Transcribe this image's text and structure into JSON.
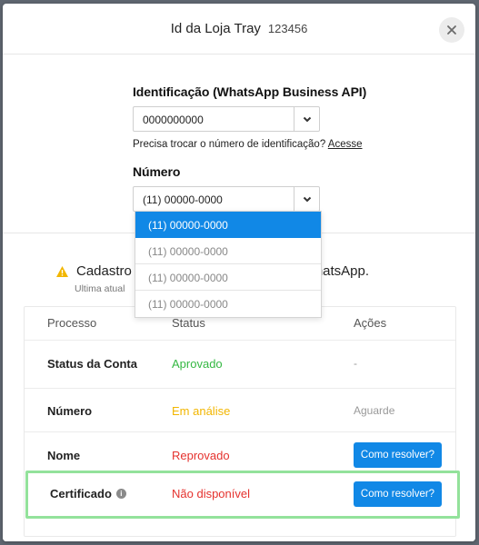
{
  "header": {
    "store_label": "Id da Loja Tray",
    "store_id": "123456"
  },
  "form": {
    "identification_label": "Identificação (WhatsApp Business API)",
    "identification_value": "0000000000",
    "helper_text": "Precisa trocar o número de identificação?",
    "helper_link": "Acesse",
    "number_label": "Número",
    "number_value": "(11) 00000-0000"
  },
  "dropdown": {
    "options": [
      "(11) 00000-0000",
      "(11) 00000-0000",
      "(11) 00000-0000",
      "(11) 00000-0000"
    ],
    "selected_index": 0
  },
  "notice": {
    "text_start": "Cadastro",
    "text_end": "m WhatsApp.",
    "subtext": "Ultima atual"
  },
  "table": {
    "headers": [
      "Processo",
      "Status",
      "Ações"
    ],
    "rows": [
      {
        "process": "Status da Conta",
        "status": "Aprovado",
        "action": "-"
      },
      {
        "process": "Número",
        "status": "Em análise",
        "action": "Aguarde"
      },
      {
        "process": "Nome",
        "status": "Reprovado",
        "action": "Como resolver?"
      },
      {
        "process": "Certificado",
        "status": "Não disponível",
        "action": "Como resolver?"
      }
    ]
  },
  "colors": {
    "primary": "#1188e6",
    "approved": "#35b843",
    "pending": "#f2b600",
    "rejected": "#e5322e",
    "highlight": "#93e29b"
  }
}
